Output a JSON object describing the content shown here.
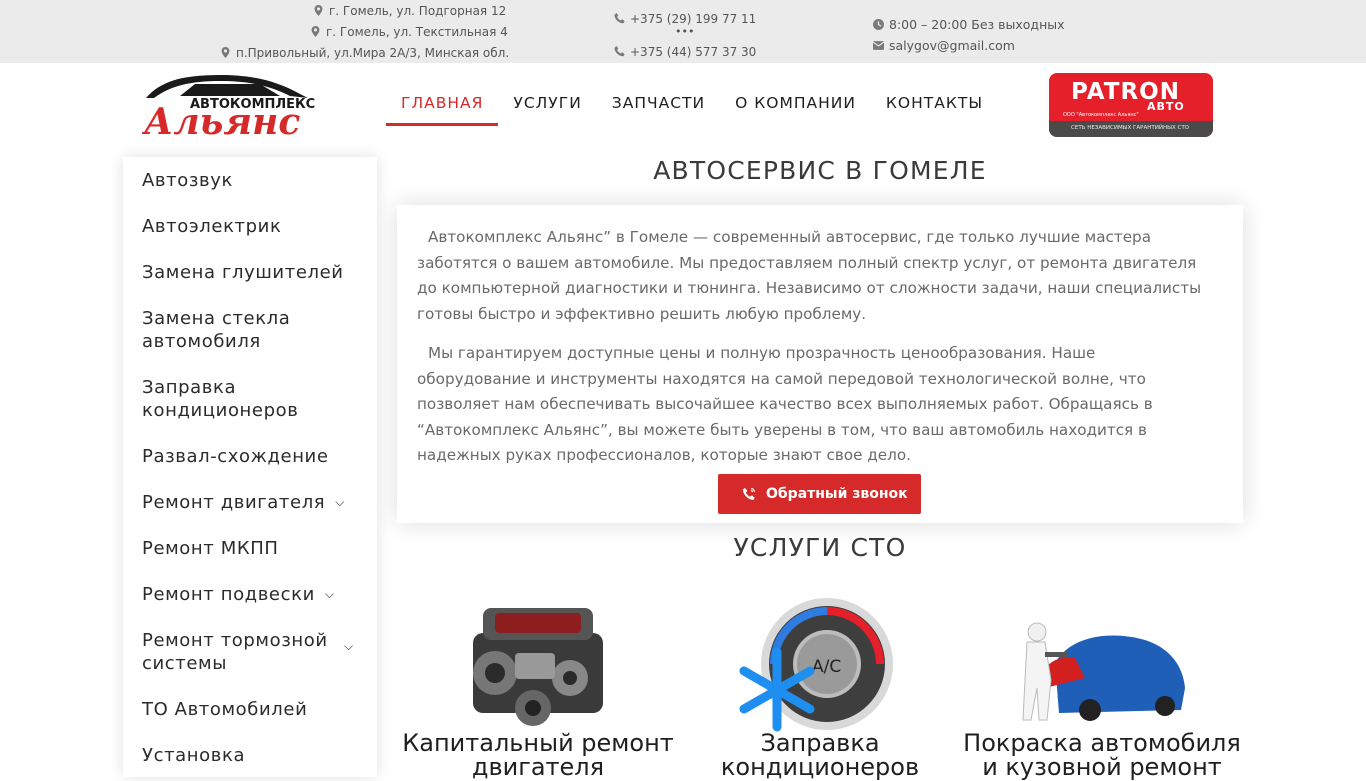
{
  "topbar": {
    "address1": "г. Гомель, ул. Подгорная 12",
    "address2": "г. Гомель, ул. Текстильная 4",
    "address3": "п.Привольный, ул.Мира 2А/3, Минская обл.",
    "phone1": "+375 (29) 199 77 11",
    "phone_dots": "•••",
    "phone2": "+375 (44) 577 37 30",
    "hours": "8:00 – 20:00 Без выходных",
    "email": "salygov@gmail.com"
  },
  "logo": {
    "small": "АВТОКОМПЛЕКС",
    "big": "Альянс"
  },
  "nav": {
    "items": [
      "ГЛАВНАЯ",
      "УСЛУГИ",
      "ЗАПЧАСТИ",
      "О КОМПАНИИ",
      "КОНТАКТЫ"
    ]
  },
  "patron": {
    "name": "PATRON",
    "sub": "АВТО",
    "small": "ООО \"Автокомплекс Альянс\"",
    "bar": "СЕТЬ НЕЗАВИСИМЫХ ГАРАНТИЙНЫХ СТО"
  },
  "sidebar": {
    "items": [
      "Автозвук",
      "Автоэлектрик",
      "Замена глушителей",
      "Замена стекла автомобиля",
      "Заправка кондиционеров",
      "Развал-схождение",
      "Ремонт двигателя",
      "Ремонт МКПП",
      "Ремонт подвески",
      "Ремонт тормозной системы",
      "ТО Автомобилей",
      "Установка"
    ]
  },
  "main": {
    "heading": "АВТОСЕРВИС В ГОМЕЛЕ",
    "para1": "Автокомплекс Альянс” в Гомеле — современный автосервис, где только лучшие мастера заботятся о вашем автомобиле. Мы предоставляем полный спектр услуг, от ремонта двигателя до компьютерной диагностики и тюнинга. Независимо от сложности задачи, наши специалисты готовы быстро и эффективно решить любую проблему.",
    "para2": "Мы гарантируем доступные цены и полную прозрачность ценообразования. Наше оборудование и инструменты находятся на самой передовой технологической волне, что позволяет нам обеспечивать высочайшее качество всех выполняемых работ. Обращаясь в “Автокомплекс Альянс”, вы можете быть уверены в том, что ваш автомобиль находится в надежных руках профессионалов, которые знают свое дело.",
    "callback_label": "Обратный звонок"
  },
  "services": {
    "heading": "УСЛУГИ СТО",
    "items": [
      {
        "title1": "Капитальный ремонт",
        "title2": "двигателя"
      },
      {
        "title1": "Заправка",
        "title2": "кондиционеров",
        "badge": "A/C"
      },
      {
        "title1": "Покраска автомобиля",
        "title2": "и кузовной ремонт"
      }
    ]
  },
  "colors": {
    "accent": "#d62a2a",
    "topbar": "#ebebeb",
    "patron": "#e5202a"
  }
}
